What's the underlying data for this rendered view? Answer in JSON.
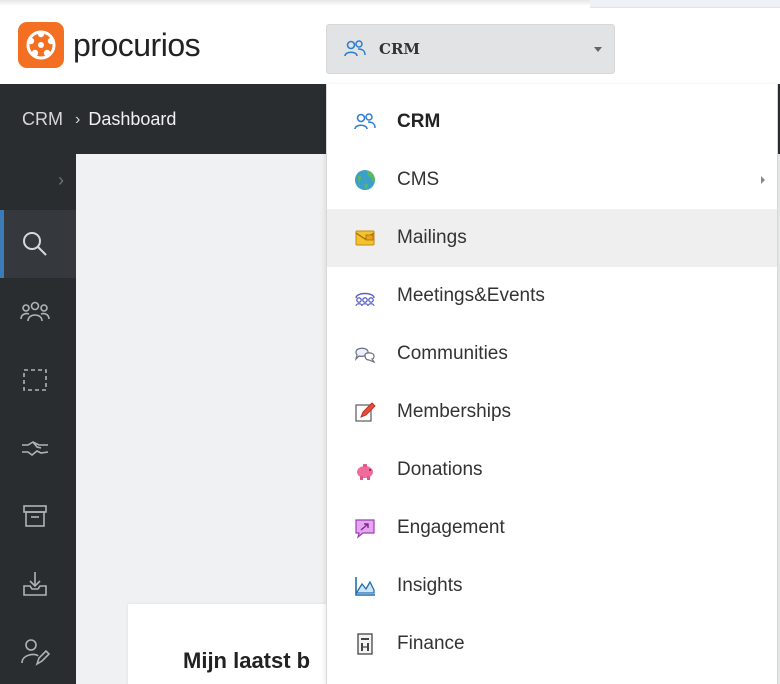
{
  "app": {
    "brand": "procurios"
  },
  "module_select": {
    "selected": "CRM",
    "icon": "users-icon"
  },
  "breadcrumb": {
    "root": "CRM",
    "separator": "›",
    "current": "Dashboard"
  },
  "sidebar": {
    "expand_icon": "chevron-right-icon",
    "items": [
      {
        "icon": "search-icon",
        "active": true
      },
      {
        "icon": "people-group-icon",
        "active": false
      },
      {
        "icon": "dashed-selection-icon",
        "active": false
      },
      {
        "icon": "handshake-icon",
        "active": false
      },
      {
        "icon": "archive-box-icon",
        "active": false
      },
      {
        "icon": "download-tray-icon",
        "active": false
      },
      {
        "icon": "user-edit-icon",
        "active": false
      }
    ]
  },
  "card": {
    "title": "Mijn laatst b"
  },
  "menu": {
    "items": [
      {
        "label": "CRM",
        "icon": "users-icon",
        "current": true
      },
      {
        "label": "CMS",
        "icon": "globe-icon",
        "has_submenu": true
      },
      {
        "label": "Mailings",
        "icon": "envelope-icon",
        "hover": true
      },
      {
        "label": "Meetings&Events",
        "icon": "meeting-icon"
      },
      {
        "label": "Communities",
        "icon": "chat-bubbles-icon"
      },
      {
        "label": "Memberships",
        "icon": "pencil-card-icon"
      },
      {
        "label": "Donations",
        "icon": "piggy-bank-icon"
      },
      {
        "label": "Engagement",
        "icon": "engagement-icon"
      },
      {
        "label": "Insights",
        "icon": "insights-chart-icon"
      },
      {
        "label": "Finance",
        "icon": "finance-document-icon"
      }
    ]
  },
  "colors": {
    "brand_orange": "#f36f21",
    "dark_bar": "#2a2d30",
    "active_accent": "#3a7bb8"
  }
}
